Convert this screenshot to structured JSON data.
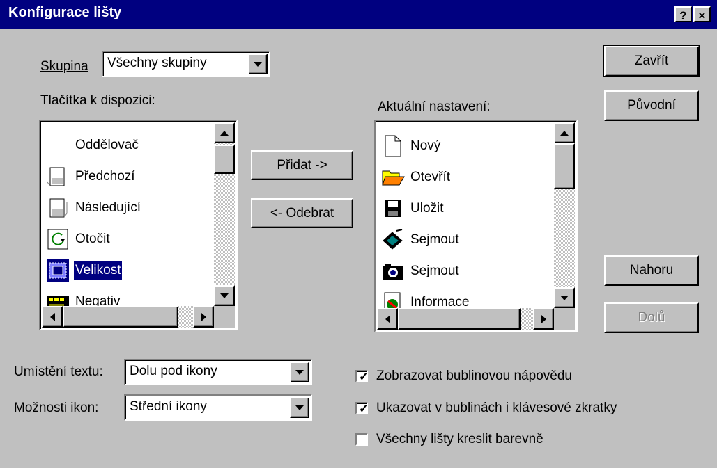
{
  "window": {
    "title": "Konfigurace lišty",
    "help_label": "?",
    "close_label": "×"
  },
  "group": {
    "label": "Skupina",
    "value": "Všechny skupiny"
  },
  "available": {
    "label": "Tlačítka k dispozici:",
    "items": [
      {
        "label": "Oddělovač",
        "icon": "separator-icon"
      },
      {
        "label": "Předchozí",
        "icon": "previous-page-icon"
      },
      {
        "label": "Následující",
        "icon": "next-page-icon"
      },
      {
        "label": "Otočit",
        "icon": "rotate-icon"
      },
      {
        "label": "Velikost",
        "icon": "size-icon",
        "selected": true
      },
      {
        "label": "Negativ",
        "icon": "negative-icon"
      }
    ]
  },
  "current": {
    "label": "Aktuální nastavení:",
    "items": [
      {
        "label": "Nový",
        "icon": "new-document-icon"
      },
      {
        "label": "Otevřít",
        "icon": "open-folder-icon"
      },
      {
        "label": "Uložit",
        "icon": "save-disk-icon"
      },
      {
        "label": "Sejmout",
        "icon": "scanner-icon"
      },
      {
        "label": "Sejmout",
        "icon": "camera-icon"
      },
      {
        "label": "Informace",
        "icon": "info-icon"
      }
    ]
  },
  "buttons": {
    "close": "Zavřít",
    "original": "Původní",
    "add": "Přidat ->",
    "remove": "<- Odebrat",
    "up": "Nahoru",
    "down": "Dolů"
  },
  "text_position": {
    "label": "Umístění textu:",
    "value": "Dolu pod ikony"
  },
  "icon_options": {
    "label": "Možnosti ikon:",
    "value": "Střední ikony"
  },
  "checkboxes": [
    {
      "label": "Zobrazovat bublinovou nápovědu",
      "checked": true
    },
    {
      "label": "Ukazovat v bublinách i klávesové zkratky",
      "checked": true
    },
    {
      "label": "Všechny lišty kreslit barevně",
      "checked": false
    }
  ],
  "colors": {
    "title_bar": "#000080",
    "face": "#c0c0c0",
    "selection": "#000080"
  }
}
